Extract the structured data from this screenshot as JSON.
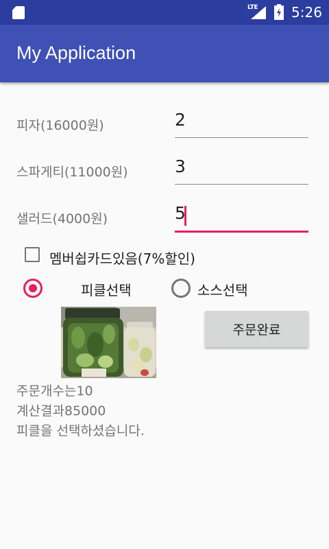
{
  "status_bar": {
    "network_label": "LTE",
    "time": "5:26",
    "icons": [
      "sd-card-icon",
      "signal-icon",
      "battery-icon"
    ]
  },
  "app_bar": {
    "title": "My Application"
  },
  "order_rows": [
    {
      "label": "피자(16000원)",
      "quantity": "2"
    },
    {
      "label": "스파게티(11000원)",
      "quantity": "3"
    },
    {
      "label": "샐러드(4000원)",
      "quantity": "5"
    }
  ],
  "membership": {
    "label": "멤버쉽카드있음(7%할인)",
    "checked": false
  },
  "side_options": [
    {
      "label": "피클선택",
      "selected": true
    },
    {
      "label": "소스선택",
      "selected": false
    }
  ],
  "photo": {
    "description_icon": "pickle-jar-photo"
  },
  "order_button": {
    "label": "주문완료"
  },
  "results": {
    "count_text": "주문개수는10",
    "total_text": "계산결과85000",
    "choice_text": "피클을 선택하셨습니다."
  },
  "colors": {
    "status_bar": "#2b3d9f",
    "app_bar": "#3f51b5",
    "accent": "#e91e63",
    "background": "#fafafa"
  }
}
